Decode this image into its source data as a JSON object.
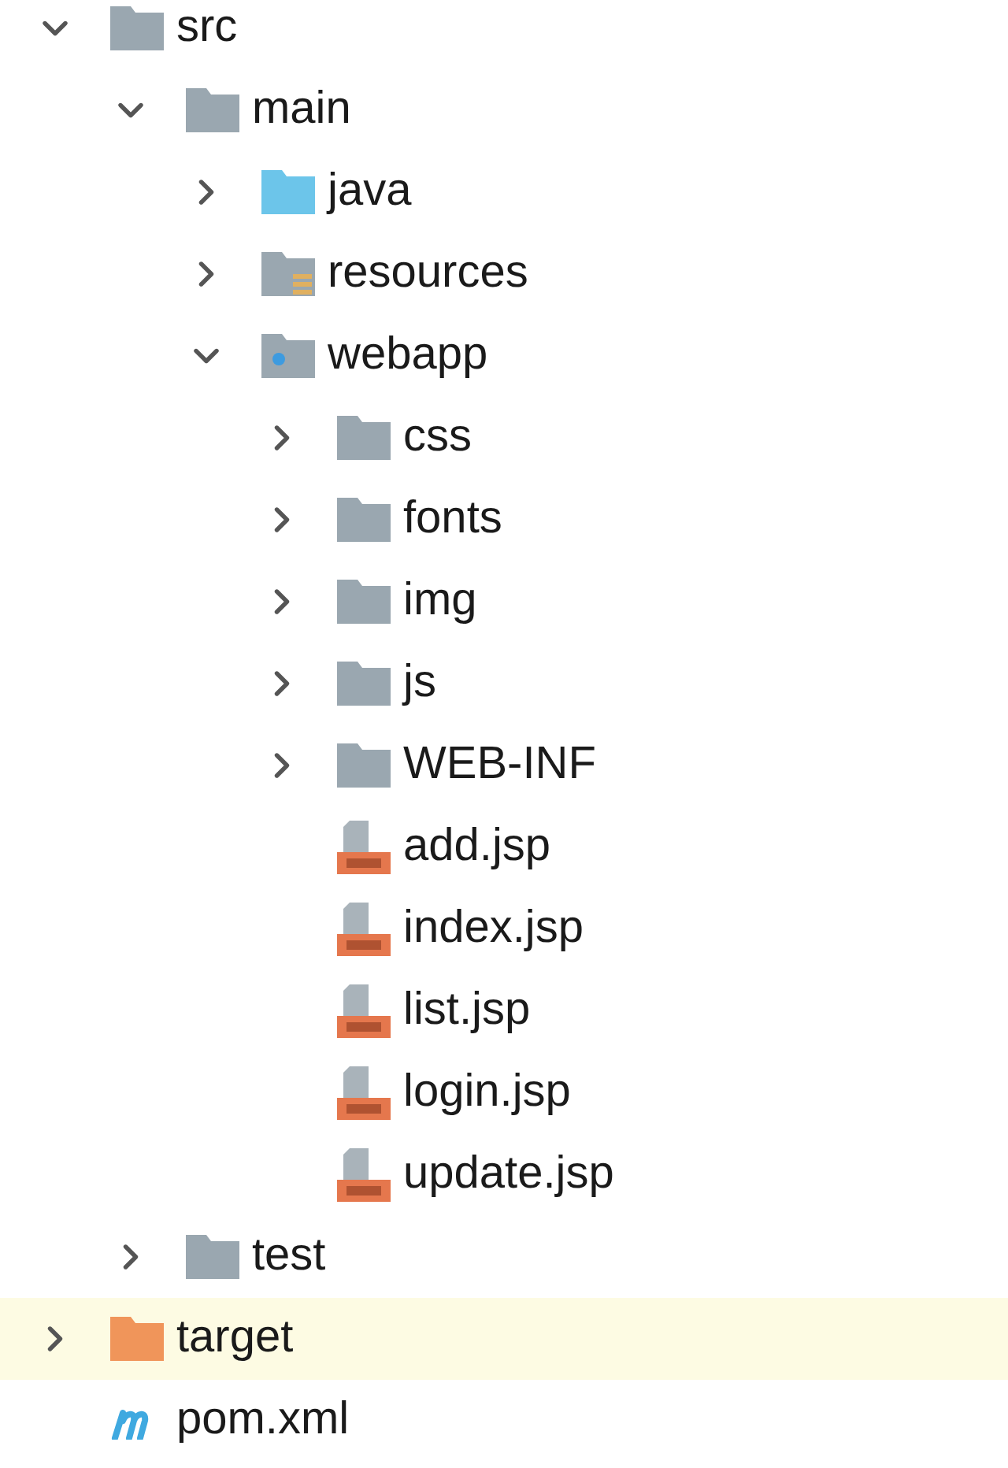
{
  "tree": [
    {
      "name": "src",
      "kind": "folder",
      "expanded": true,
      "selected": false,
      "children": [
        {
          "name": "main",
          "kind": "folder",
          "expanded": true,
          "selected": false,
          "children": [
            {
              "name": "java",
              "kind": "source_folder",
              "expanded": false,
              "selected": false
            },
            {
              "name": "resources",
              "kind": "resource_folder",
              "expanded": false,
              "selected": false
            },
            {
              "name": "webapp",
              "kind": "web_folder",
              "expanded": true,
              "selected": false,
              "children": [
                {
                  "name": "css",
                  "kind": "folder",
                  "expanded": false,
                  "selected": false
                },
                {
                  "name": "fonts",
                  "kind": "folder",
                  "expanded": false,
                  "selected": false
                },
                {
                  "name": "img",
                  "kind": "folder",
                  "expanded": false,
                  "selected": false
                },
                {
                  "name": "js",
                  "kind": "folder",
                  "expanded": false,
                  "selected": false
                },
                {
                  "name": "WEB-INF",
                  "kind": "folder",
                  "expanded": false,
                  "selected": false
                },
                {
                  "name": "add.jsp",
                  "kind": "jsp",
                  "selected": false
                },
                {
                  "name": "index.jsp",
                  "kind": "jsp",
                  "selected": false
                },
                {
                  "name": "list.jsp",
                  "kind": "jsp",
                  "selected": false
                },
                {
                  "name": "login.jsp",
                  "kind": "jsp",
                  "selected": false
                },
                {
                  "name": "update.jsp",
                  "kind": "jsp",
                  "selected": false
                }
              ]
            }
          ]
        },
        {
          "name": "test",
          "kind": "folder",
          "expanded": false,
          "selected": false
        }
      ]
    },
    {
      "name": "target",
      "kind": "excluded_folder",
      "expanded": false,
      "selected": true
    },
    {
      "name": "pom.xml",
      "kind": "maven",
      "selected": false
    }
  ]
}
